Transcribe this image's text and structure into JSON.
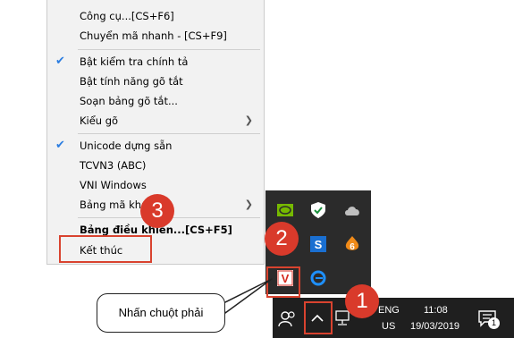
{
  "menu": {
    "items": [
      {
        "label": "Công cụ...[CS+F6]"
      },
      {
        "label": "Chuyển mã nhanh - [CS+F9]"
      },
      {
        "label": "Bật kiểm tra chính tả"
      },
      {
        "label": "Bật tính năng gõ tắt"
      },
      {
        "label": "Soạn bảng gõ tắt..."
      },
      {
        "label": "Kiểu gõ"
      },
      {
        "label": "Unicode dựng sẵn"
      },
      {
        "label": "TCVN3 (ABC)"
      },
      {
        "label": "VNI Windows"
      },
      {
        "label": "Bảng mã khác"
      },
      {
        "label": "Bảng điều khiển...[CS+F5]"
      },
      {
        "label": "Kết thúc"
      }
    ]
  },
  "taskbar": {
    "lang_top": "ENG",
    "lang_bottom": "US",
    "time": "11:08",
    "date": "19/03/2019",
    "notification_count": "1"
  },
  "annotations": {
    "step1": "1",
    "step2": "2",
    "step3": "3",
    "callout": "Nhấn chuột phải"
  },
  "colors": {
    "annotation_red": "#d93a2b",
    "check_blue": "#2b7de1",
    "taskbar_bg": "#1f1f1f"
  }
}
